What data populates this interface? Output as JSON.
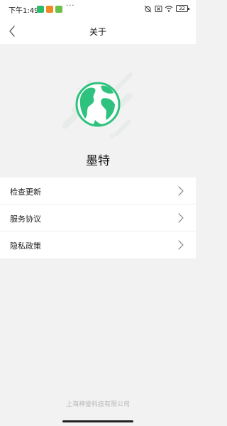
{
  "status_bar": {
    "time": "下午1:49",
    "notifications": [
      {
        "icon": "wechat-notif-icon",
        "color": "#2dbb6a"
      },
      {
        "icon": "app-notif-icon",
        "color": "#f08a24"
      },
      {
        "icon": "app-notif-icon-2",
        "color": "#6cc04a"
      }
    ],
    "more": "···",
    "battery": "32"
  },
  "header": {
    "title": "关于"
  },
  "app": {
    "name": "墨特",
    "brand_color": "#2ec27e"
  },
  "menu": [
    {
      "label": "检查更新"
    },
    {
      "label": "服务协议"
    },
    {
      "label": "隐私政策"
    }
  ],
  "footer": {
    "company": "上海神誉科技有限公司"
  }
}
